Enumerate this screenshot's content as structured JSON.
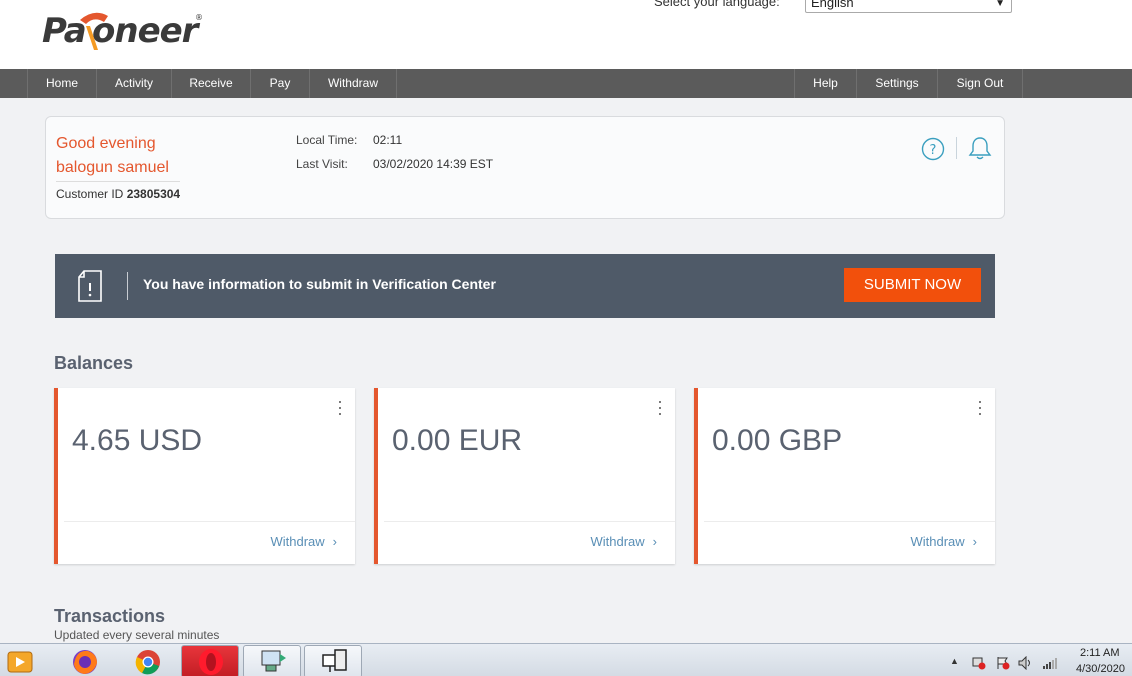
{
  "header": {
    "logo_text": "Payoneer",
    "language_label": "Select your language:",
    "language_value": "English"
  },
  "nav": {
    "left": [
      "Home",
      "Activity",
      "Receive",
      "Pay",
      "Withdraw"
    ],
    "right": [
      "Help",
      "Settings",
      "Sign Out"
    ]
  },
  "welcome": {
    "greeting": "Good evening",
    "name": "balogun samuel",
    "customer_id_label": "Customer ID",
    "customer_id": "23805304",
    "local_time_label": "Local Time:",
    "local_time": "02:11",
    "last_visit_label": "Last Visit:",
    "last_visit": "03/02/2020 14:39 EST"
  },
  "verification": {
    "message": "You have information to submit in Verification Center",
    "button": "SUBMIT NOW"
  },
  "balances": {
    "title": "Balances",
    "cards": [
      {
        "amount": "4.65 USD",
        "action": "Withdraw"
      },
      {
        "amount": "0.00 EUR",
        "action": "Withdraw"
      },
      {
        "amount": "0.00 GBP",
        "action": "Withdraw"
      }
    ]
  },
  "transactions": {
    "title": "Transactions",
    "subtitle": "Updated every several minutes"
  },
  "taskbar": {
    "time": "2:11 AM",
    "date": "4/30/2020"
  },
  "colors": {
    "accent": "#e4572e",
    "nav_bg": "#5b5b5b",
    "banner_bg": "#4f5a68",
    "button": "#f2500c"
  }
}
